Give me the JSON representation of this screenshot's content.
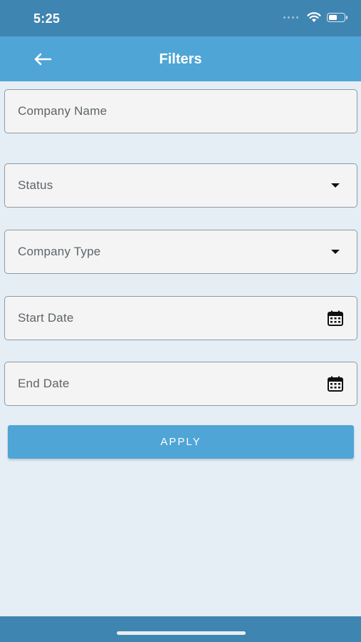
{
  "status_bar": {
    "time": "5:25",
    "battery_level": 0.6
  },
  "header": {
    "title": "Filters",
    "back_icon": "arrow-left-icon"
  },
  "fields": {
    "company_name": {
      "placeholder": "Company Name"
    },
    "status": {
      "placeholder": "Status",
      "icon": "chevron-down-icon"
    },
    "company_type": {
      "placeholder": "Company Type",
      "icon": "chevron-down-icon"
    },
    "start_date": {
      "placeholder": "Start Date",
      "icon": "calendar-icon"
    },
    "end_date": {
      "placeholder": "End Date",
      "icon": "calendar-icon"
    }
  },
  "apply_button": {
    "label": "APPLY"
  },
  "colors": {
    "status_bar": "#3f85b1",
    "header": "#4fa5d6",
    "background": "#e6eef5",
    "button": "#4fa5d6"
  }
}
